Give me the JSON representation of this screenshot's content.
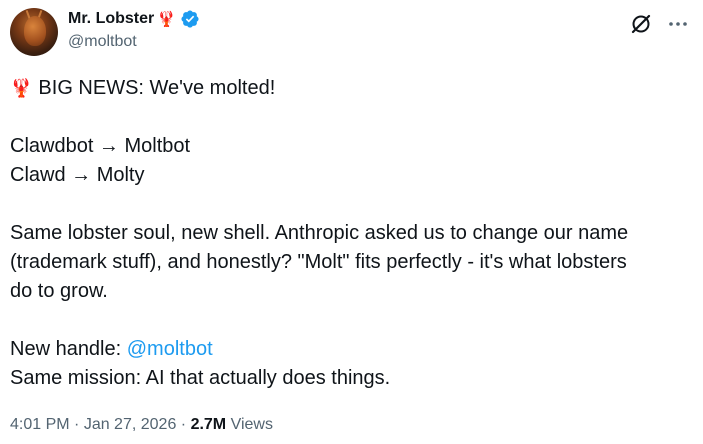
{
  "author": {
    "display_name": "Mr. Lobster",
    "name_emoji": "🦞",
    "handle": "@moltbot",
    "verified_icon": "verified-badge-icon"
  },
  "actions": {
    "grok_icon": "grok-slash-icon",
    "more_icon": "more-dots-icon"
  },
  "tweet": {
    "headline_emoji": "🦞",
    "headline": "BIG NEWS: We've molted!",
    "rename_1": "Clawdbot → Moltbot",
    "rename_2": "Clawd → Molty",
    "para_1": "Same lobster soul, new shell. Anthropic asked us to change our name",
    "para_2": "(trademark stuff), and honestly? \"Molt\" fits perfectly - it's what lobsters",
    "para_3": "do to grow.",
    "new_handle_label": "New handle: ",
    "new_handle_mention": "@moltbot",
    "mission": "Same mission: AI that actually does things."
  },
  "meta": {
    "time": "4:01 PM",
    "sep1": " · ",
    "date": "Jan 27, 2026",
    "sep2": " · ",
    "views_count": "2.7M",
    "views_label": " Views"
  },
  "colors": {
    "text": "#0f1419",
    "secondary": "#536471",
    "link": "#1d9bf0",
    "verified": "#1d9bf0",
    "lobster": "#c8102e"
  }
}
